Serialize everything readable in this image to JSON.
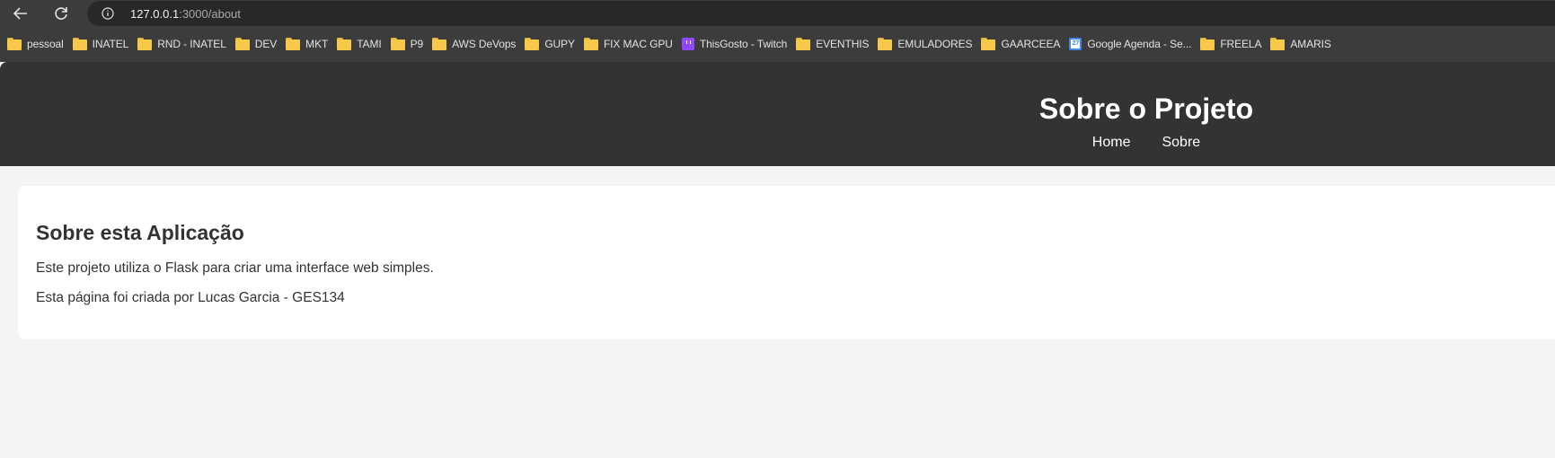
{
  "browser": {
    "url_host": "127.0.0.1",
    "url_path": ":3000/about",
    "bookmarks": [
      {
        "label": "pessoal",
        "icon": "folder-icon"
      },
      {
        "label": "INATEL",
        "icon": "folder-icon"
      },
      {
        "label": "RND - INATEL",
        "icon": "folder-icon"
      },
      {
        "label": "DEV",
        "icon": "folder-icon"
      },
      {
        "label": "MKT",
        "icon": "folder-icon"
      },
      {
        "label": "TAMI",
        "icon": "folder-icon"
      },
      {
        "label": "P9",
        "icon": "folder-icon"
      },
      {
        "label": "AWS DeVops",
        "icon": "folder-icon"
      },
      {
        "label": "GUPY",
        "icon": "folder-icon"
      },
      {
        "label": "FIX MAC GPU",
        "icon": "folder-icon"
      },
      {
        "label": "ThisGosto - Twitch",
        "icon": "twitch-icon"
      },
      {
        "label": "EVENTHIS",
        "icon": "folder-icon"
      },
      {
        "label": "EMULADORES",
        "icon": "folder-icon"
      },
      {
        "label": "GAARCEEA",
        "icon": "folder-icon"
      },
      {
        "label": "Google Agenda - Se...",
        "icon": "google-calendar-icon"
      },
      {
        "label": "FREELA",
        "icon": "folder-icon"
      },
      {
        "label": "AMARIS",
        "icon": "folder-icon"
      }
    ],
    "gcal_day": "27"
  },
  "header": {
    "title": "Sobre o Projeto",
    "nav": {
      "home": "Home",
      "about": "Sobre"
    }
  },
  "content": {
    "heading": "Sobre esta Aplicação",
    "paragraph1": "Este projeto utiliza o Flask para criar uma interface web simples.",
    "paragraph2": "Esta página foi criada por Lucas Garcia - GES134"
  },
  "colors": {
    "header_bg": "#333333",
    "page_bg": "#f4f4f4",
    "card_bg": "#ffffff",
    "text": "#333333"
  }
}
